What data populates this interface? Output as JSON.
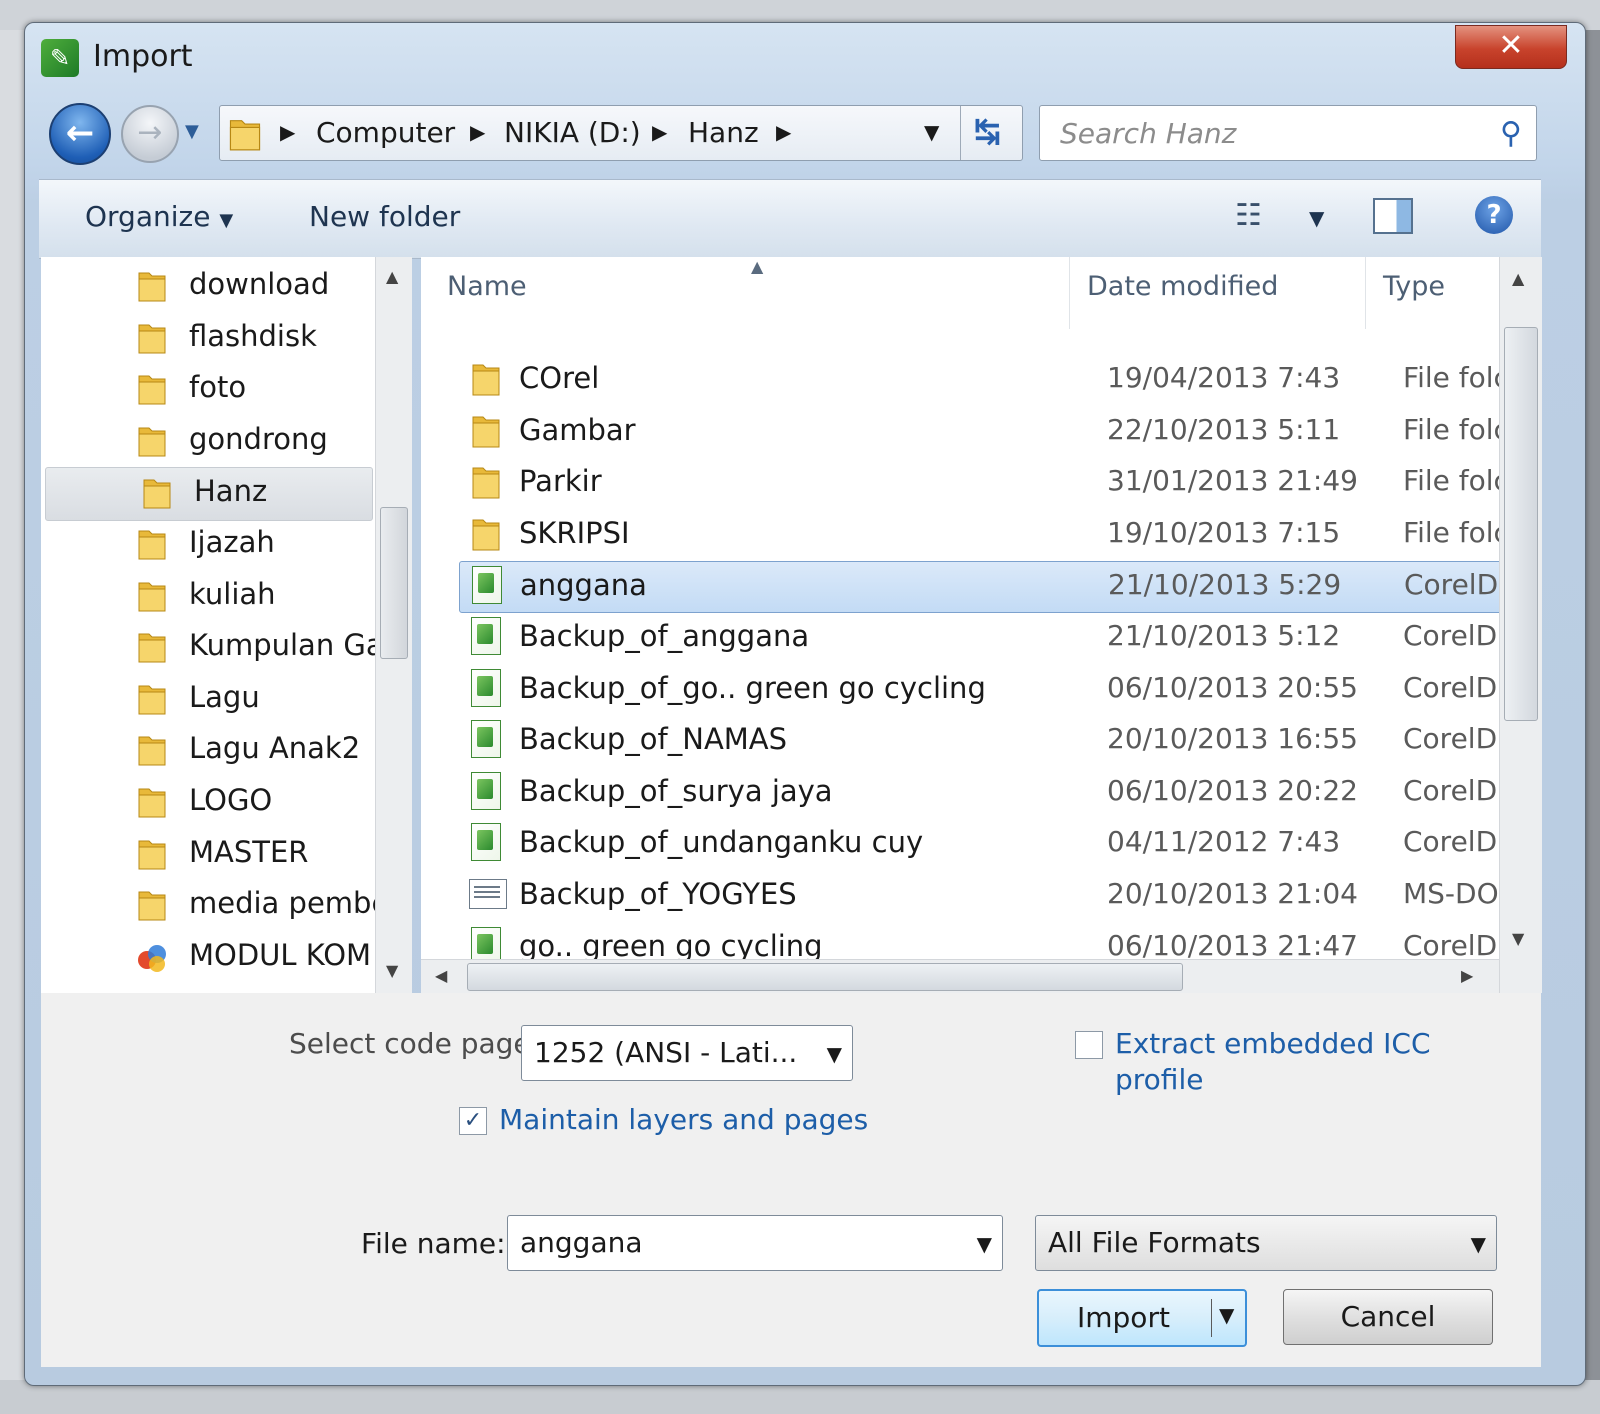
{
  "window": {
    "title": "Import",
    "close_label": "✕"
  },
  "address": {
    "crumbs": [
      "Computer",
      "NIKIA (D:)",
      "Hanz"
    ]
  },
  "search": {
    "placeholder": "Search Hanz"
  },
  "toolbar": {
    "organize": "Organize",
    "new_folder": "New folder"
  },
  "nav": {
    "items": [
      {
        "label": "download",
        "icon": "folder-icon"
      },
      {
        "label": "flashdisk",
        "icon": "folder-icon"
      },
      {
        "label": "foto",
        "icon": "folder-icon"
      },
      {
        "label": "gondrong",
        "icon": "folder-icon"
      },
      {
        "label": "Hanz",
        "icon": "folder-icon",
        "selected": true
      },
      {
        "label": "Ijazah",
        "icon": "folder-icon"
      },
      {
        "label": "kuliah",
        "icon": "folder-icon"
      },
      {
        "label": "Kumpulan Ga",
        "icon": "folder-icon"
      },
      {
        "label": "Lagu",
        "icon": "folder-icon"
      },
      {
        "label": "Lagu Anak2",
        "icon": "folder-icon"
      },
      {
        "label": "LOGO",
        "icon": "folder-icon"
      },
      {
        "label": "MASTER",
        "icon": "folder-icon"
      },
      {
        "label": "media pembe",
        "icon": "folder-icon"
      },
      {
        "label": "MODUL KOM",
        "icon": "office-icon"
      }
    ]
  },
  "list": {
    "columns": {
      "name": "Name",
      "date": "Date modified",
      "type": "Type"
    },
    "rows": [
      {
        "name": "COrel",
        "date": "19/04/2013 7:43",
        "type": "File folc",
        "icon": "folder-icon"
      },
      {
        "name": "Gambar",
        "date": "22/10/2013 5:11",
        "type": "File folc",
        "icon": "folder-icon"
      },
      {
        "name": "Parkir",
        "date": "31/01/2013 21:49",
        "type": "File folc",
        "icon": "folder-icon"
      },
      {
        "name": "SKRIPSI",
        "date": "19/10/2013 7:15",
        "type": "File folc",
        "icon": "folder-icon"
      },
      {
        "name": "anggana",
        "date": "21/10/2013 5:29",
        "type": "CorelDF",
        "icon": "coreldraw-file-icon",
        "selected": true
      },
      {
        "name": "Backup_of_anggana",
        "date": "21/10/2013 5:12",
        "type": "CorelDF",
        "icon": "coreldraw-file-icon"
      },
      {
        "name": "Backup_of_go.. green go cycling",
        "date": "06/10/2013 20:55",
        "type": "CorelDF",
        "icon": "coreldraw-file-icon"
      },
      {
        "name": "Backup_of_NAMAS",
        "date": "20/10/2013 16:55",
        "type": "CorelDF",
        "icon": "coreldraw-file-icon"
      },
      {
        "name": "Backup_of_surya jaya",
        "date": "06/10/2013 20:22",
        "type": "CorelDF",
        "icon": "coreldraw-file-icon"
      },
      {
        "name": "Backup_of_undanganku cuy",
        "date": "04/11/2012 7:43",
        "type": "CorelDF",
        "icon": "coreldraw-file-icon"
      },
      {
        "name": "Backup_of_YOGYES",
        "date": "20/10/2013 21:04",
        "type": "MS-DO:",
        "icon": "msdos-file-icon"
      },
      {
        "name": "go.. green go cycling",
        "date": "06/10/2013 21:47",
        "type": "CorelDF",
        "icon": "coreldraw-file-icon"
      }
    ]
  },
  "options": {
    "code_page_label": "Select code page",
    "code_page_value": "1252  (ANSI - Lati...",
    "extract_icc_label_1": "Extract embedded ICC",
    "extract_icc_label_2": "profile",
    "extract_icc_checked": false,
    "maintain_layers_label": "Maintain layers and pages",
    "maintain_layers_checked": true,
    "file_name_label": "File name:",
    "file_name_value": "anggana",
    "file_type_value": "All File Formats",
    "import_button": "Import",
    "cancel_button": "Cancel"
  },
  "colors": {
    "accent": "#1d5ea8",
    "selection": "#c3dbf5"
  }
}
